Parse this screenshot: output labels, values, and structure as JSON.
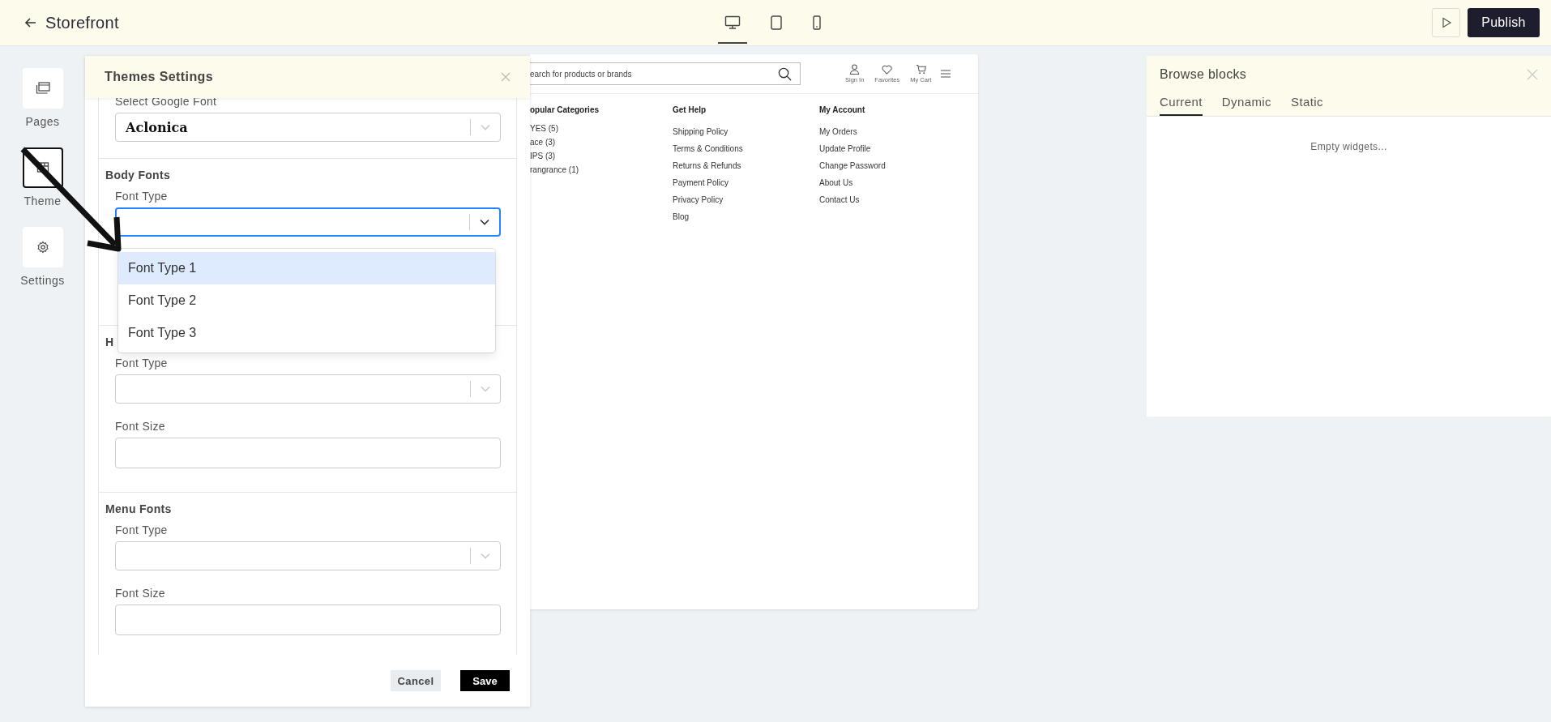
{
  "top_bar": {
    "title": "Storefront",
    "devices": [
      {
        "kind": "desktop",
        "selected": true
      },
      {
        "kind": "tablet",
        "selected": false
      },
      {
        "kind": "phone",
        "selected": false
      }
    ],
    "publish": "Publish"
  },
  "sidebar": {
    "items": [
      {
        "kind": "pages",
        "label": "Pages",
        "selected": false
      },
      {
        "kind": "theme",
        "label": "Theme",
        "selected": true
      },
      {
        "kind": "settings",
        "label": "Settings",
        "selected": false
      }
    ]
  },
  "themes_panel": {
    "title": "Themes Settings",
    "google_font": {
      "label": "Select Google Font",
      "value": "Aclonica"
    },
    "sections": [
      {
        "heading": "Body Fonts",
        "fields": [
          {
            "kind": "select",
            "label": "Font Type",
            "focused": true
          }
        ]
      },
      {
        "heading": "H",
        "fields": [
          {
            "kind": "select",
            "label": "Font Type",
            "focused": false
          },
          {
            "kind": "text",
            "label": "Font Size"
          }
        ]
      },
      {
        "heading": "Menu Fonts",
        "fields": [
          {
            "kind": "select",
            "label": "Font Type",
            "focused": false
          },
          {
            "kind": "text",
            "label": "Font Size"
          }
        ]
      }
    ],
    "dropdown": {
      "options": [
        {
          "label": "Font Type 1",
          "selected": true
        },
        {
          "label": "Font Type 2",
          "selected": false
        },
        {
          "label": "Font Type 3",
          "selected": false
        }
      ]
    },
    "cancel": "Cancel",
    "save": "Save"
  },
  "preview": {
    "search": {
      "placeholder": "earch for products or brands"
    },
    "actions": [
      {
        "kind": "user",
        "label": "Sign In"
      },
      {
        "kind": "heart",
        "label": "Favorites"
      },
      {
        "kind": "cart",
        "label": "My Cart"
      }
    ],
    "columns": [
      {
        "heading": "opular Categories",
        "links": [
          "YES (5)",
          "ace (3)",
          "IPS (3)",
          "rangrance (1)"
        ]
      },
      {
        "heading": "Get Help",
        "links": [
          "Shipping Policy",
          "Terms & Conditions",
          "Returns & Refunds",
          "Payment Policy",
          "Privacy Policy",
          "Blog"
        ]
      },
      {
        "heading": "My Account",
        "links": [
          "My Orders",
          "Update Profile",
          "Change Password",
          "About Us",
          "Contact Us"
        ]
      }
    ]
  },
  "blocks_panel": {
    "title": "Browse blocks",
    "tabs": [
      {
        "label": "Current",
        "selected": true
      },
      {
        "label": "Dynamic",
        "selected": false
      },
      {
        "label": "Static",
        "selected": false
      }
    ],
    "empty_text": "Empty widgets..."
  }
}
